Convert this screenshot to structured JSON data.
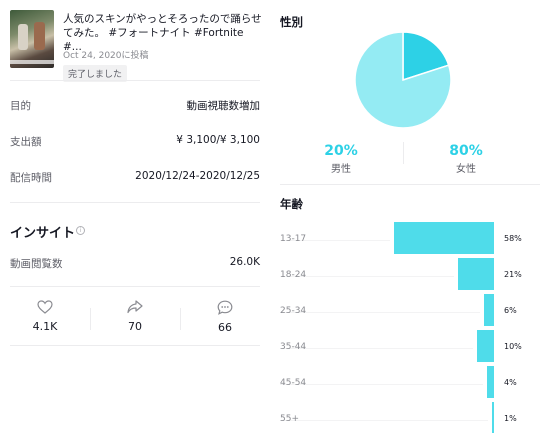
{
  "video": {
    "title": "人気のスキンがやっとそろったので踊らせてみた。 #フォートナイト #Fortnite #...",
    "date": "Oct 24, 2020に投稿",
    "status": "完了しました"
  },
  "details": [
    {
      "label": "目的",
      "value": "動画視聴数増加"
    },
    {
      "label": "支出額",
      "value": "¥ 3,100/¥ 3,100"
    },
    {
      "label": "配信時間",
      "value": "2020/12/24-2020/12/25"
    }
  ],
  "insight": {
    "title": "インサイト",
    "views_label": "動画閲覧数",
    "views_value": "26.0K"
  },
  "stats": {
    "likes": "4.1K",
    "shares": "70",
    "comments": "66"
  },
  "gender": {
    "title": "性別",
    "male_pct": "20%",
    "male_label": "男性",
    "female_pct": "80%",
    "female_label": "女性"
  },
  "colors": {
    "accent": "#2dd1e6",
    "male_slice": "#2dd1e6",
    "female_slice": "#94ebf3",
    "bar": "#4fdcea"
  },
  "chart_data": [
    {
      "type": "pie",
      "title": "性別",
      "categories": [
        "男性",
        "女性"
      ],
      "values": [
        20,
        80
      ]
    },
    {
      "type": "bar",
      "title": "年齢",
      "orientation": "horizontal",
      "categories": [
        "13-17",
        "18-24",
        "25-34",
        "35-44",
        "45-54",
        "55+"
      ],
      "values": [
        58,
        21,
        6,
        10,
        4,
        1
      ],
      "value_labels": [
        "58%",
        "21%",
        "6%",
        "10%",
        "4%",
        "1%"
      ]
    }
  ]
}
